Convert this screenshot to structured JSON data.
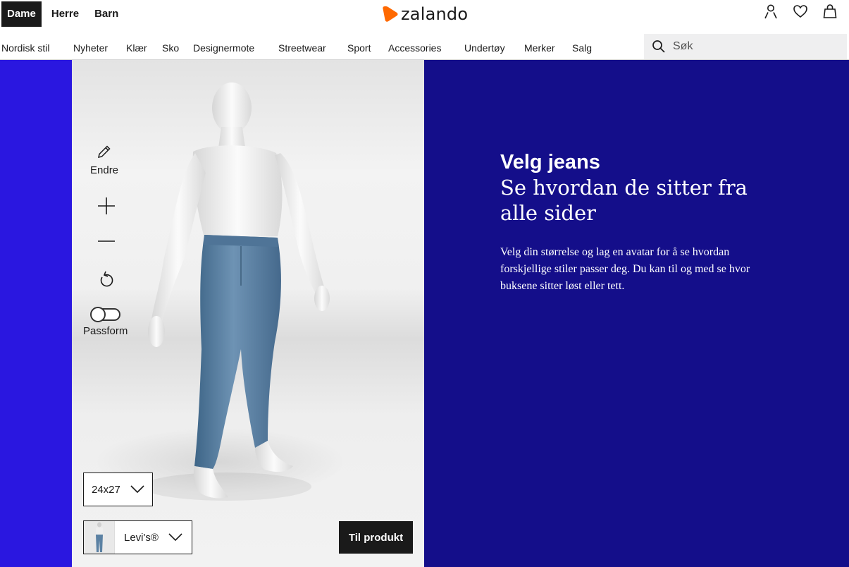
{
  "header": {
    "gender_tabs": [
      "Dame",
      "Herre",
      "Barn"
    ],
    "active_gender": "Dame",
    "brand": "zalando",
    "brand_color": "#ff6900",
    "icons": [
      "user-icon",
      "heart-icon",
      "bag-icon"
    ]
  },
  "nav": {
    "categories": [
      "Nordisk stil",
      "Nyheter",
      "Klær",
      "Sko",
      "Designermote",
      "Streetwear",
      "Sport",
      "Accessories",
      "Undertøy",
      "Merker",
      "Salg"
    ]
  },
  "search": {
    "placeholder": "Søk"
  },
  "viewer": {
    "edit_label": "Endre",
    "fit_label": "Passform",
    "fit_toggle_on": false,
    "size_value": "24x27",
    "brand_value": "Levi's®",
    "cta_label": "Til produkt"
  },
  "promo": {
    "title": "Velg jeans",
    "subtitle": "Se hvordan de sitter fra alle sider",
    "body": "Velg din størrelse og lag en avatar for å se hvordan forskjellige stiler passer deg. Du kan til og med se hvor buksene sitter løst eller tett."
  },
  "colors": {
    "left_strip": "#2a17e0",
    "promo_background": "#140e8a",
    "text_dark": "#1a1a1a"
  }
}
